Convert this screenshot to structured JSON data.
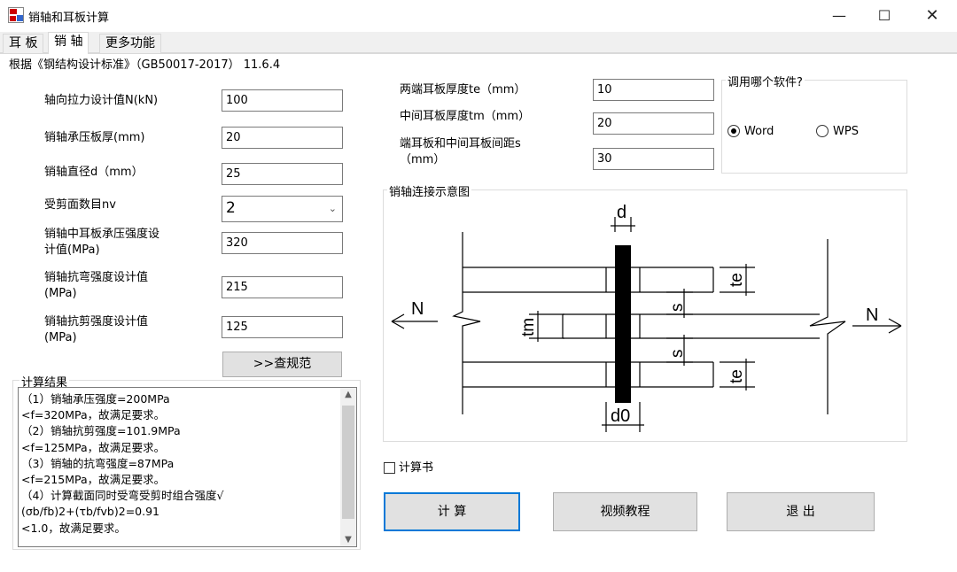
{
  "window": {
    "title": "销轴和耳板计算"
  },
  "tabs": [
    {
      "label": "耳 板"
    },
    {
      "label": "销 轴"
    },
    {
      "label": "更多功能"
    }
  ],
  "header": {
    "standard": "根据《钢结构设计标准》（GB50017-2017） 11.6.4"
  },
  "inputs": {
    "axial_force": {
      "label": "轴向拉力设计值N(kN)",
      "value": "100"
    },
    "bearing_plate": {
      "label": "销轴承压板厚(mm)",
      "value": "20"
    },
    "diameter": {
      "label": "销轴直径d（mm）",
      "value": "25"
    },
    "shear_planes": {
      "label": "受剪面数目nv",
      "value": "2"
    },
    "bearing_strength": {
      "label_1": "销轴中耳板承压强度设",
      "label_2": "计值(MPa)",
      "value": "320"
    },
    "bending_strength": {
      "label_1": "销轴抗弯强度设计值",
      "label_2": "(MPa)",
      "value": "215"
    },
    "shear_strength": {
      "label_1": "销轴抗剪强度设计值",
      "label_2": "(MPa)",
      "value": "125"
    },
    "end_plate_te": {
      "label": "两端耳板厚度te（mm）",
      "value": "10"
    },
    "mid_plate_tm": {
      "label": "中间耳板厚度tm（mm）",
      "value": "20"
    },
    "spacing_s": {
      "label_1": "端耳板和中间耳板间距s",
      "label_2": "（mm）",
      "value": "30"
    }
  },
  "buttons": {
    "lookup_code": ">>查规范",
    "calculate": "计 算",
    "video": "视频教程",
    "exit": "退 出"
  },
  "software": {
    "title": "调用哪个软件?",
    "options": [
      "Word",
      "WPS"
    ],
    "selected": "Word"
  },
  "diagram": {
    "title": "销轴连接示意图",
    "labels": {
      "d": "d",
      "d0": "d0",
      "te": "te",
      "tm": "tm",
      "s": "s",
      "n": "N"
    }
  },
  "results": {
    "title": "计算结果",
    "text": "（1）销轴承压强度=200MPa\n<f=320MPa，故满足要求。\n（2）销轴抗剪强度=101.9MPa\n<f=125MPa，故满足要求。\n（3）销轴的抗弯强度=87MPa\n<f=215MPa，故满足要求。\n（4）计算截面同时受弯受剪时组合强度√\n(σb/fb)2+(τb/fvb)2=0.91\n<1.0，故满足要求。"
  },
  "report_checkbox": {
    "label": "计算书",
    "checked": false
  }
}
